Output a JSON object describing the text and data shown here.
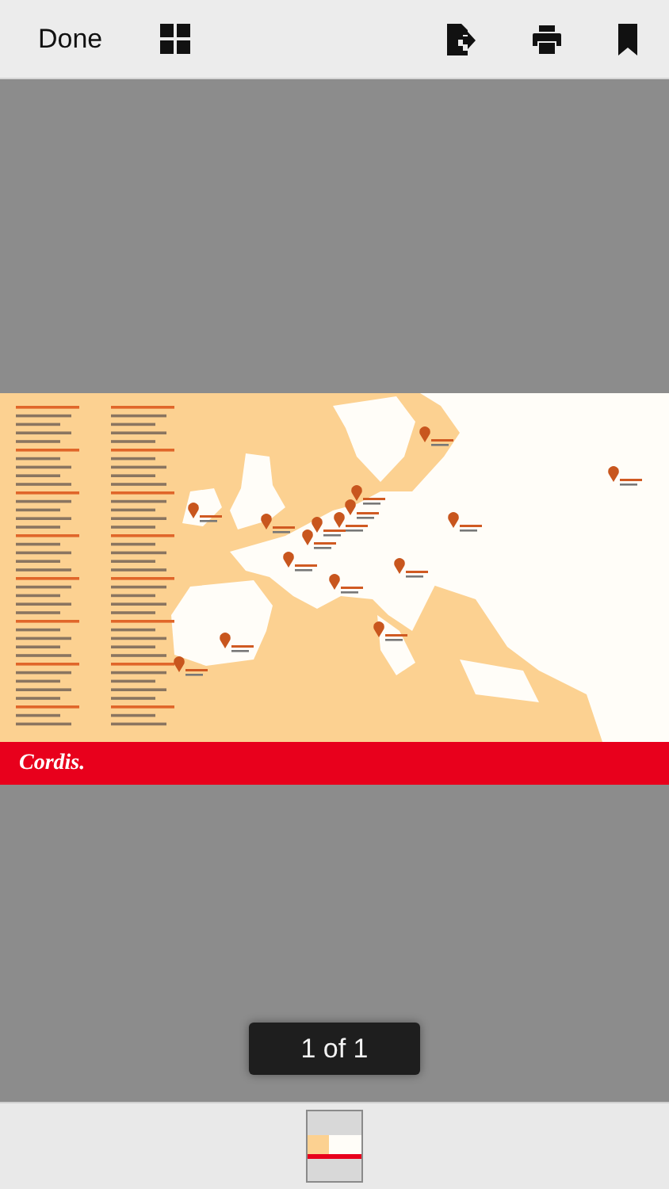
{
  "toolbar": {
    "done_label": "Done"
  },
  "document": {
    "logo": "Cordis."
  },
  "page_indicator": "1 of 1",
  "thumbnails": [
    {
      "selected": true
    }
  ]
}
